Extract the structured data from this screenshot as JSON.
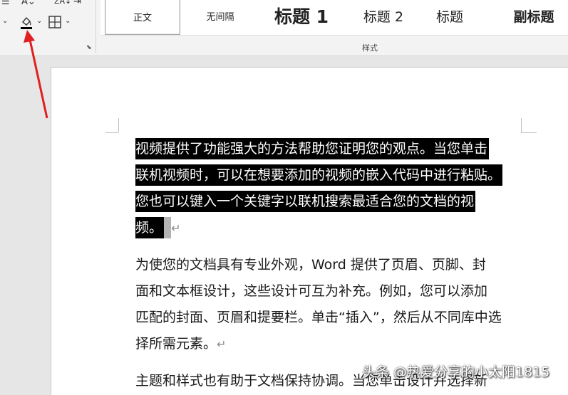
{
  "ribbon": {
    "styles": [
      {
        "label": "正文"
      },
      {
        "label": "无间隔"
      },
      {
        "label": "标题 1"
      },
      {
        "label": "标题 2"
      },
      {
        "label": "标题"
      },
      {
        "label": "副标题"
      }
    ],
    "group_label": "样式",
    "colors": {
      "highlight_bar": "#000000",
      "arrow": "#e02020"
    }
  },
  "document": {
    "para1": [
      "视频提供了功能强大的方法帮助您证明您的观点。当您单击",
      "联机视频时，可以在想要添加的视频的嵌入代码中进行粘贴。",
      "您也可以键入一个关键字以联机搜索最适合您的文档的视",
      "频。"
    ],
    "para2": [
      "为使您的文档具有专业外观，Word 提供了页眉、页脚、封",
      "面和文本框设计，这些设计可互为补充。例如，您可以添加",
      "匹配的封面、页眉和提要栏。单击“插入”，然后从不同库中选",
      "择所需元素。"
    ],
    "para3": [
      "主题和样式也有助于文档保持协调。当您单击设计并选择新"
    ],
    "paragraph_mark": "↵"
  },
  "watermark": "头条 @热爱分享的小太阳1815"
}
